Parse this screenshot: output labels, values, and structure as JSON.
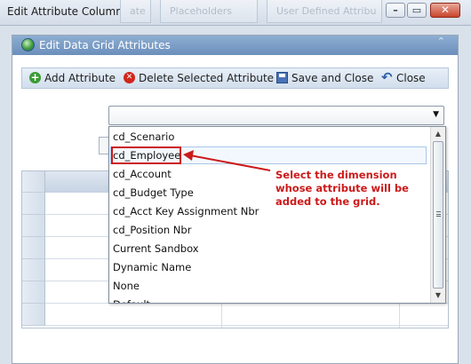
{
  "window": {
    "title": "Edit Attribute Columns",
    "bg_tabs": [
      "ate",
      "Placeholders",
      "User Defined Attribu"
    ],
    "minimize_glyph": "–",
    "maximize_glyph": "▭",
    "close_glyph": "✕"
  },
  "panel": {
    "title": "Edit Data Grid Attributes",
    "collapse_glyph": "⌃"
  },
  "toolbar": {
    "add_label": "Add Attribute",
    "delete_label": "Delete Selected Attribute",
    "save_close_label": "Save and Close",
    "close_label": "Close",
    "add_glyph": "+",
    "delete_glyph": "✕",
    "close_glyph": "↶"
  },
  "combo": {
    "value": "",
    "arrow_glyph": "▼"
  },
  "dropdown": {
    "items": [
      "cd_Scenario",
      "cd_Employee",
      "cd_Account",
      "cd_Budget Type",
      "cd_Acct Key Assignment Nbr",
      "cd_Position Nbr",
      "Current Sandbox",
      "Dynamic Name",
      "None",
      "Default"
    ],
    "selected": "cd_Employee",
    "scroll_up_glyph": "▲",
    "scroll_down_glyph": "▼"
  },
  "annotation": {
    "text": "Select the dimension whose attribute will be added to the grid."
  },
  "colors": {
    "annotation": "#cc1a1a",
    "panel_header": "#7899c4",
    "selection_border": "#cc1a1a"
  }
}
